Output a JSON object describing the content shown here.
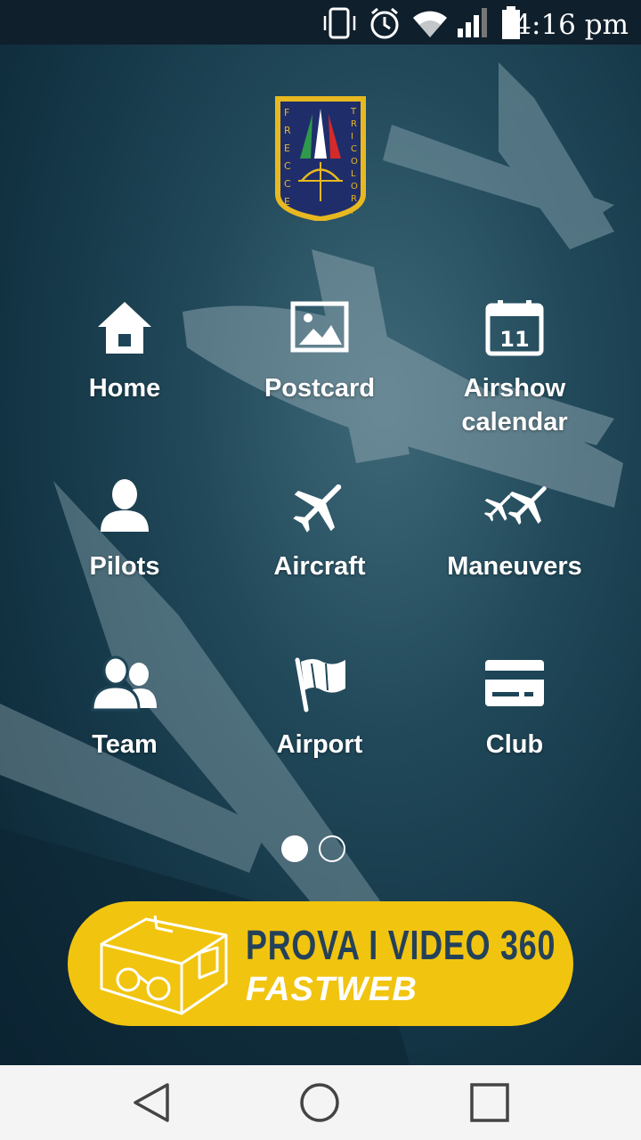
{
  "status_bar": {
    "time": "4:16 pm",
    "icons": [
      "vibrate-icon",
      "alarm-icon",
      "wifi-icon",
      "signal-icon",
      "battery-icon"
    ]
  },
  "logo": {
    "left_text": "FRECCE",
    "right_text": "TRICOLORI"
  },
  "menu": [
    {
      "label": "Home",
      "icon": "home-icon"
    },
    {
      "label": "Postcard",
      "icon": "picture-icon"
    },
    {
      "label": "Airshow\ncalendar",
      "icon": "calendar-icon"
    },
    {
      "label": "Pilots",
      "icon": "user-icon"
    },
    {
      "label": "Aircraft",
      "icon": "airplane-icon"
    },
    {
      "label": "Maneuvers",
      "icon": "maneuvers-icon"
    },
    {
      "label": "Team",
      "icon": "team-icon"
    },
    {
      "label": "Airport",
      "icon": "flag-icon"
    },
    {
      "label": "Club",
      "icon": "card-icon"
    }
  ],
  "calendar_day": "11",
  "pagination": {
    "current": 1,
    "total": 2
  },
  "banner": {
    "line1": "PROVA I VIDEO 360",
    "line2": "FASTWEB"
  },
  "nav": [
    "back-icon",
    "home-circle-icon",
    "recents-icon"
  ],
  "colors": {
    "banner_bg": "#f1c40f",
    "banner_text": "#24415a",
    "background": "#1d4557",
    "logo_border": "#e8b820",
    "logo_bg": "#1f2e6b"
  }
}
